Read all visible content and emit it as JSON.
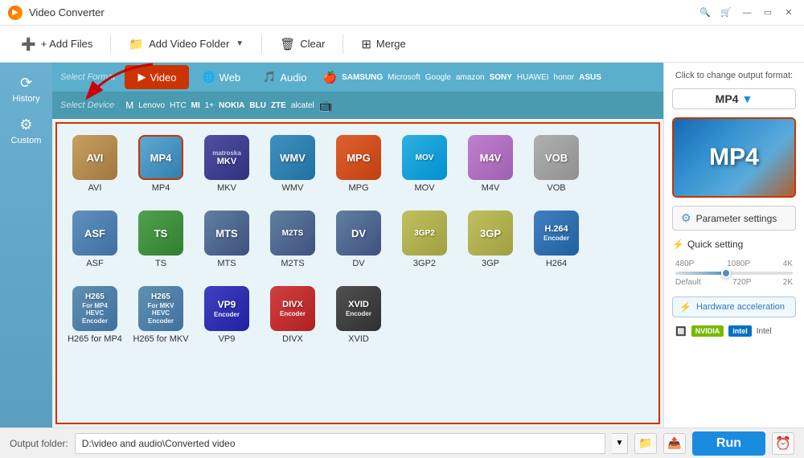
{
  "app": {
    "title": "Video Converter",
    "icon": "▶"
  },
  "titlebar": {
    "search_icon": "🔍",
    "cart_icon": "🛒",
    "minimize": "—",
    "close": "✕"
  },
  "toolbar": {
    "add_files": "+ Add Files",
    "add_video_folder": "Add Video Folder",
    "clear": "Clear",
    "merge": "Merge"
  },
  "left_panel": {
    "items": [
      {
        "id": "history",
        "label": "History",
        "icon": "⟳"
      },
      {
        "id": "custom",
        "label": "Custom",
        "icon": "⚙"
      }
    ]
  },
  "format_tabs": {
    "select_format": "Select Format",
    "select_device": "Select Device",
    "tabs": [
      {
        "id": "video",
        "label": "Video",
        "active": true
      },
      {
        "id": "audio",
        "label": "Audio",
        "active": false
      },
      {
        "id": "web",
        "label": "Web",
        "active": false
      }
    ]
  },
  "device_brands": [
    "🍎",
    "SAMSUNG",
    "Microsoft",
    "Google",
    "Amazon",
    "SONY",
    "HUAWEI",
    "honor",
    "ASUS"
  ],
  "device_brands2": [
    "Motorola",
    "Lenovo",
    "HTC",
    "MI",
    "OnePlus",
    "NOKIA",
    "BLU",
    "ZTE",
    "alcatel",
    "TV"
  ],
  "formats": [
    {
      "id": "avi",
      "label": "AVI",
      "class": "fmt-avi",
      "text": "AVI",
      "sub": ""
    },
    {
      "id": "mp4",
      "label": "MP4",
      "class": "fmt-mp4",
      "text": "MP4",
      "sub": ""
    },
    {
      "id": "mkv",
      "label": "MKV",
      "class": "fmt-mkv",
      "text": "MKV",
      "sub": "matroska"
    },
    {
      "id": "wmv",
      "label": "WMV",
      "class": "fmt-wmv",
      "text": "WMV",
      "sub": ""
    },
    {
      "id": "mpg",
      "label": "MPG",
      "class": "fmt-mpg",
      "text": "MPG",
      "sub": ""
    },
    {
      "id": "mov",
      "label": "MOV",
      "class": "fmt-mov",
      "text": "MOV",
      "sub": ""
    },
    {
      "id": "m4v",
      "label": "M4V",
      "class": "fmt-m4v",
      "text": "M4V",
      "sub": ""
    },
    {
      "id": "vob",
      "label": "VOB",
      "class": "fmt-vob",
      "text": "VOB",
      "sub": ""
    },
    {
      "id": "asf",
      "label": "ASF",
      "class": "fmt-asf",
      "text": "ASF",
      "sub": ""
    },
    {
      "id": "ts",
      "label": "TS",
      "class": "fmt-ts",
      "text": "TS",
      "sub": ""
    },
    {
      "id": "mts",
      "label": "MTS",
      "class": "fmt-mts",
      "text": "MTS",
      "sub": ""
    },
    {
      "id": "m2ts",
      "label": "M2TS",
      "class": "fmt-m2ts",
      "text": "M2TS",
      "sub": ""
    },
    {
      "id": "dv",
      "label": "DV",
      "class": "fmt-dv",
      "text": "DV",
      "sub": ""
    },
    {
      "id": "3gp2",
      "label": "3GP2",
      "class": "fmt-3gp2",
      "text": "3GP2",
      "sub": ""
    },
    {
      "id": "3gp",
      "label": "3GP",
      "class": "fmt-3gp",
      "text": "3GP",
      "sub": ""
    },
    {
      "id": "h264",
      "label": "H264",
      "class": "fmt-h264",
      "text": "H.264",
      "sub": "Encoder"
    },
    {
      "id": "h265mp4",
      "label": "H265 for MP4",
      "class": "fmt-h265mp4",
      "text": "H265",
      "sub": "For MP4 HEVC Encoder"
    },
    {
      "id": "h265mkv",
      "label": "H265 for MKV",
      "class": "fmt-h265mkv",
      "text": "H265",
      "sub": "For MKV HEVC Encoder"
    },
    {
      "id": "vp9",
      "label": "VP9",
      "class": "fmt-vp9",
      "text": "VP9",
      "sub": "Encoder"
    },
    {
      "id": "divx",
      "label": "DIVX",
      "class": "fmt-divx",
      "text": "DIVX",
      "sub": "Encoder"
    },
    {
      "id": "xvid",
      "label": "XVID",
      "class": "fmt-xvid",
      "text": "XVID",
      "sub": "Encoder"
    }
  ],
  "right_sidebar": {
    "output_format_label": "Click to change output format:",
    "output_format": "MP4",
    "dropdown_icon": "▼",
    "parameter_settings": "Parameter settings",
    "quick_setting": "Quick setting",
    "quality_levels_top": [
      "480P",
      "1080P",
      "4K"
    ],
    "quality_levels_bottom": [
      "Default",
      "720P",
      "2K"
    ],
    "hardware_acceleration": "Hardware acceleration",
    "nvidia_label": "NVIDIA",
    "intel_label": "Intel"
  },
  "bottom_bar": {
    "output_label": "Output folder:",
    "output_path": "D:\\video and audio\\Converted video",
    "run_label": "Run",
    "alarm_icon": "⏰"
  }
}
